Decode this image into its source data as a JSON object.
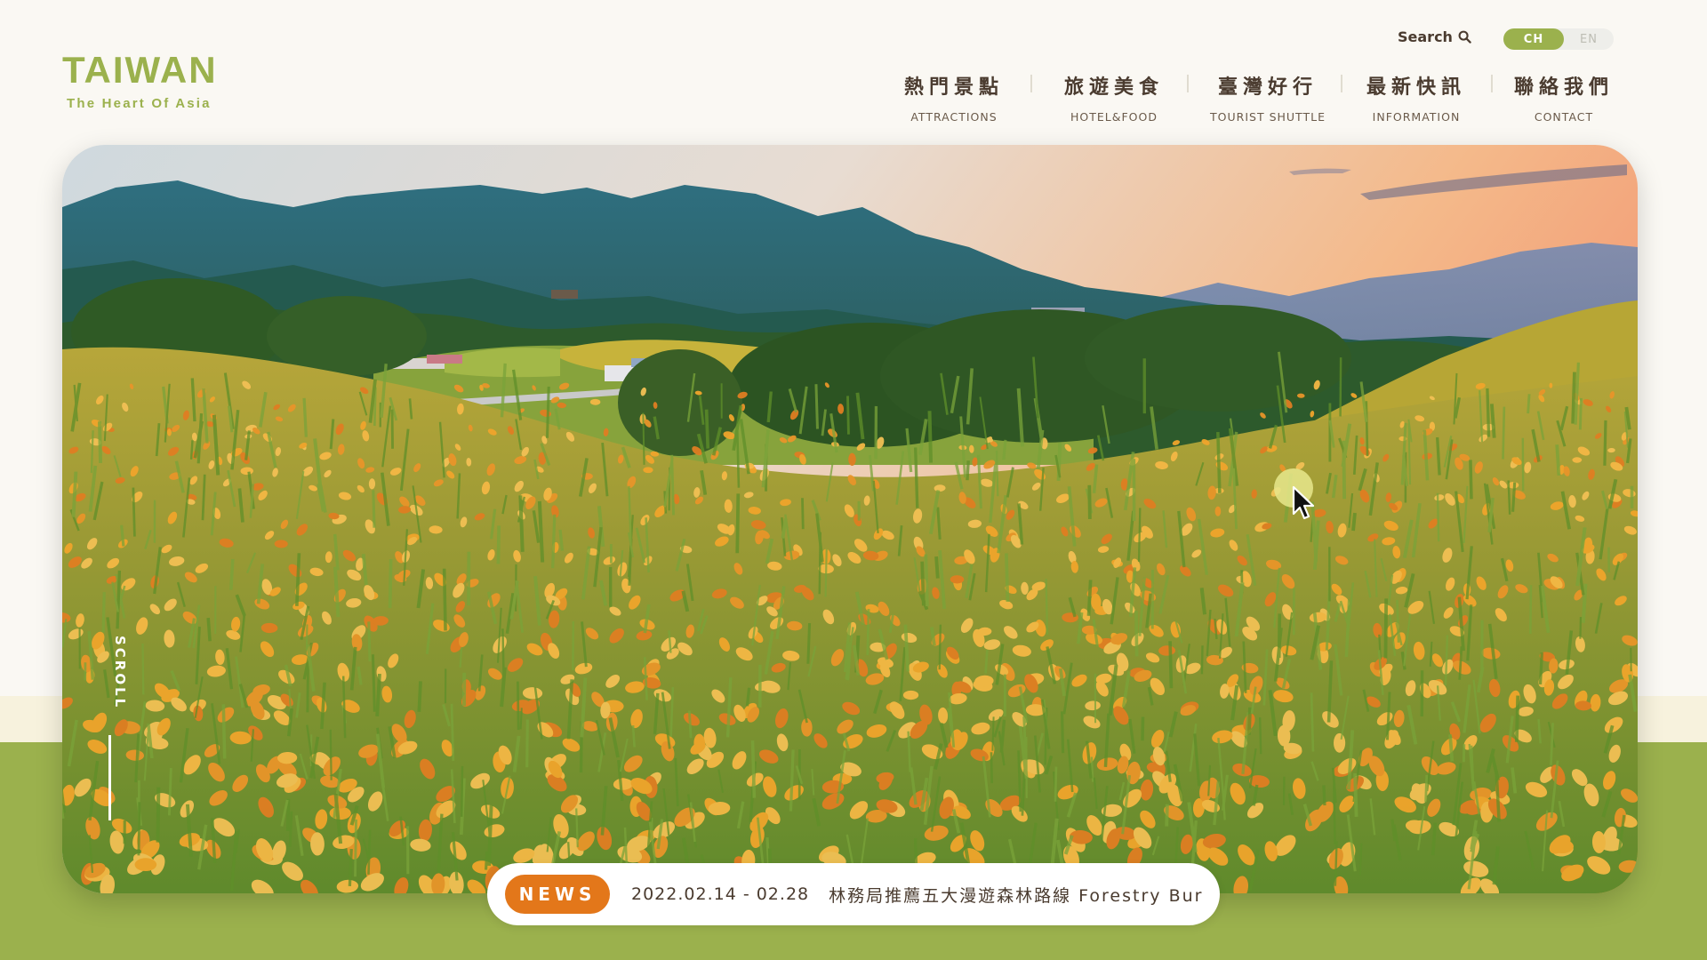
{
  "logo": {
    "title": "TAIWAN",
    "subtitle": "The Heart Of Asia"
  },
  "search": {
    "label": "Search"
  },
  "language": {
    "options": [
      "CH",
      "EN"
    ],
    "active": "CH"
  },
  "nav": [
    {
      "zh": "熱門景點",
      "en": "ATTRACTIONS"
    },
    {
      "zh": "旅遊美食",
      "en": "HOTEL&FOOD"
    },
    {
      "zh": "臺灣好行",
      "en": "TOURIST SHUTTLE"
    },
    {
      "zh": "最新快訊",
      "en": "INFORMATION"
    },
    {
      "zh": "聯絡我們",
      "en": "CONTACT"
    }
  ],
  "hero": {
    "scroll_label": "SCROLL"
  },
  "news": {
    "badge": "NEWS",
    "date": "2022.02.14 - 02.28",
    "title": "林務局推薦五大漫遊森林路線 Forestry Bur"
  },
  "colors": {
    "brand_green": "#9bb14d",
    "accent_orange": "#e3771a",
    "text_brown": "#4a3b2f"
  },
  "icons": [
    "search-icon",
    "mouse-cursor-icon"
  ]
}
